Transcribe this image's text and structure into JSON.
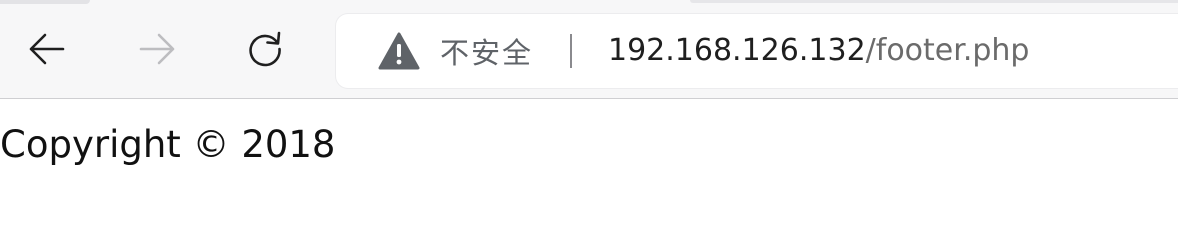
{
  "toolbar": {
    "back_icon": "arrow-left-icon",
    "forward_icon": "arrow-right-icon",
    "reload_icon": "reload-icon"
  },
  "address_bar": {
    "security_icon": "warning-triangle-icon",
    "security_label": "不安全",
    "url_host": "192.168.126.132",
    "url_path": "/footer.php"
  },
  "page": {
    "footer_text": "Copyright © 2018"
  },
  "colors": {
    "toolbar_bg": "#f7f7f8",
    "icon_active": "#1f1f1f",
    "icon_disabled": "#bdbdc0",
    "security_text": "#5f6368",
    "url_host": "#1f1f1f",
    "url_path": "#6b6b6b"
  }
}
